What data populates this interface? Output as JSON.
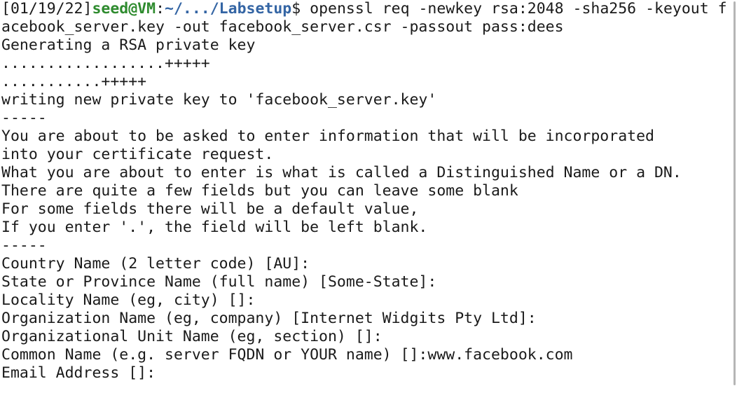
{
  "prompt": {
    "timestamp": "[01/19/22]",
    "user_host": "seed@VM",
    "separator": ":",
    "path": "~/.../Labsetup",
    "symbol": "$"
  },
  "command_line_1": " openssl req -newkey rsa:2048 -sha256 -keyout f",
  "command_line_2": "acebook_server.key -out facebook_server.csr -passout pass:dees",
  "output_lines": [
    "Generating a RSA private key",
    "..................+++++",
    "...........+++++",
    "writing new private key to 'facebook_server.key'",
    "-----",
    "You are about to be asked to enter information that will be incorporated",
    "into your certificate request.",
    "What you are about to enter is what is called a Distinguished Name or a DN.",
    "There are quite a few fields but you can leave some blank",
    "For some fields there will be a default value,",
    "If you enter '.', the field will be left blank.",
    "-----",
    "Country Name (2 letter code) [AU]:",
    "State or Province Name (full name) [Some-State]:",
    "Locality Name (eg, city) []:",
    "Organization Name (eg, company) [Internet Widgits Pty Ltd]:",
    "Organizational Unit Name (eg, section) []:",
    "Common Name (e.g. server FQDN or YOUR name) []:www.facebook.com",
    "Email Address []:"
  ],
  "colors": {
    "background": "#ffffff",
    "text": "#1a1a1a",
    "user_host": "#2e8b2e",
    "path": "#3465a4"
  }
}
